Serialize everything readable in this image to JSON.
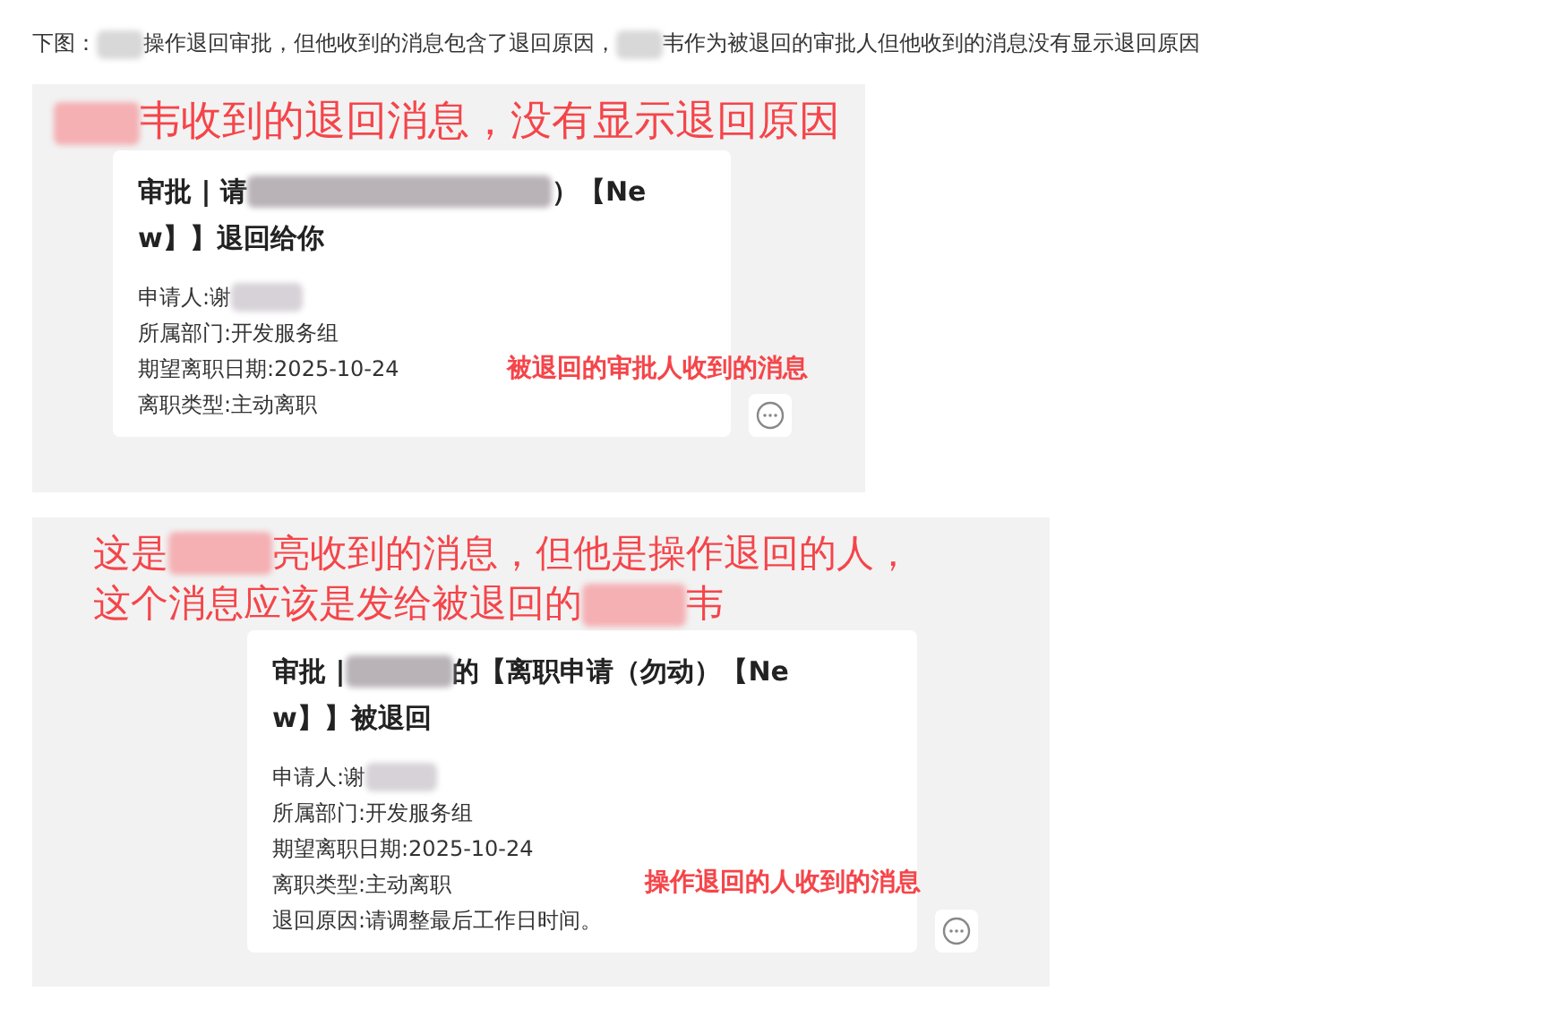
{
  "intro": [
    {
      "kind": "text",
      "text": "下图："
    },
    {
      "kind": "blur"
    },
    {
      "kind": "text",
      "text": "操作退回审批，但他收到的消息包含了退回原因，"
    },
    {
      "kind": "blur"
    },
    {
      "kind": "text",
      "text": "韦作为被退回的审批人但他收到的消息没有显示退回原因"
    }
  ],
  "panels": [
    {
      "caption": [
        [
          {
            "kind": "blur"
          },
          {
            "kind": "text",
            "text": "韦收到的退回消息，没有显示退回原因"
          }
        ]
      ],
      "title": [
        [
          {
            "kind": "text",
            "text": "审批 | 请"
          },
          {
            "kind": "blur"
          },
          {
            "kind": "text",
            "text": "）【Ne"
          }
        ],
        [
          {
            "kind": "text",
            "text": "w】】退回给你"
          }
        ]
      ],
      "fields": [
        [
          {
            "kind": "text",
            "text": "申请人:谢"
          },
          {
            "kind": "blur"
          }
        ],
        [
          {
            "kind": "text",
            "text": "所属部门:开发服务组"
          }
        ],
        [
          {
            "kind": "text",
            "text": "期望离职日期:2025-10-24"
          }
        ],
        [
          {
            "kind": "text",
            "text": "离职类型:主动离职"
          }
        ]
      ],
      "note": "被退回的审批人收到的消息"
    },
    {
      "caption": [
        [
          {
            "kind": "text",
            "text": "这是"
          },
          {
            "kind": "blur"
          },
          {
            "kind": "text",
            "text": "亮收到的消息，但他是操作退回的人，"
          }
        ],
        [
          {
            "kind": "text",
            "text": "这个消息应该是发给被退回的"
          },
          {
            "kind": "blur"
          },
          {
            "kind": "text",
            "text": "韦"
          }
        ]
      ],
      "title": [
        [
          {
            "kind": "text",
            "text": "审批 | "
          },
          {
            "kind": "blur"
          },
          {
            "kind": "text",
            "text": "的【离职申请（勿动）【Ne"
          }
        ],
        [
          {
            "kind": "text",
            "text": "w】】被退回"
          }
        ]
      ],
      "fields": [
        [
          {
            "kind": "text",
            "text": "申请人:谢"
          },
          {
            "kind": "blur"
          }
        ],
        [
          {
            "kind": "text",
            "text": "所属部门:开发服务组"
          }
        ],
        [
          {
            "kind": "text",
            "text": "期望离职日期:2025-10-24"
          }
        ],
        [
          {
            "kind": "text",
            "text": "离职类型:主动离职"
          }
        ],
        [
          {
            "kind": "text",
            "text": "退回原因:请调整最后工作日时间。"
          }
        ]
      ],
      "note": "操作退回的人收到的消息"
    }
  ]
}
